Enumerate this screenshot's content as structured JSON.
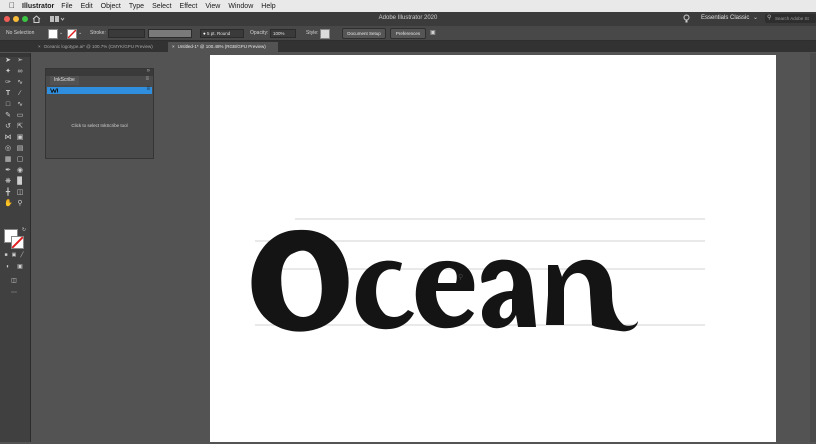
{
  "menubar": {
    "app_name": "Illustrator",
    "items": [
      "File",
      "Edit",
      "Object",
      "Type",
      "Select",
      "Effect",
      "View",
      "Window",
      "Help"
    ]
  },
  "appbar": {
    "title": "Adobe Illustrator 2020",
    "workspace": "Essentials Classic",
    "search_placeholder": "Search Adobe St"
  },
  "controlbar": {
    "selection": "No Selection",
    "stroke_label": "Stroke:",
    "brush": "5 pt. Round",
    "opacity_label": "Opacity:",
    "opacity_value": "100%",
    "style_label": "Style:",
    "document_setup": "Document Setup",
    "preferences": "Preferences"
  },
  "tabs": [
    {
      "label": "Oceanic logotype.ai* @ 100.7% (CMYK/GPU Preview)",
      "active": false
    },
    {
      "label": "Untitled-1* @ 100.48% (RGB/GPU Preview)",
      "active": true
    }
  ],
  "inkscribe": {
    "tab_label": "InkScribe",
    "hint": "Click to select InkScribe tool"
  },
  "artwork": {
    "word": "Ocean"
  },
  "colors": {
    "accent_blue": "#2f8fde",
    "menubar_bg": "#e9e9e9",
    "canvas_bg": "#535353",
    "artboard": "#ffffff"
  }
}
